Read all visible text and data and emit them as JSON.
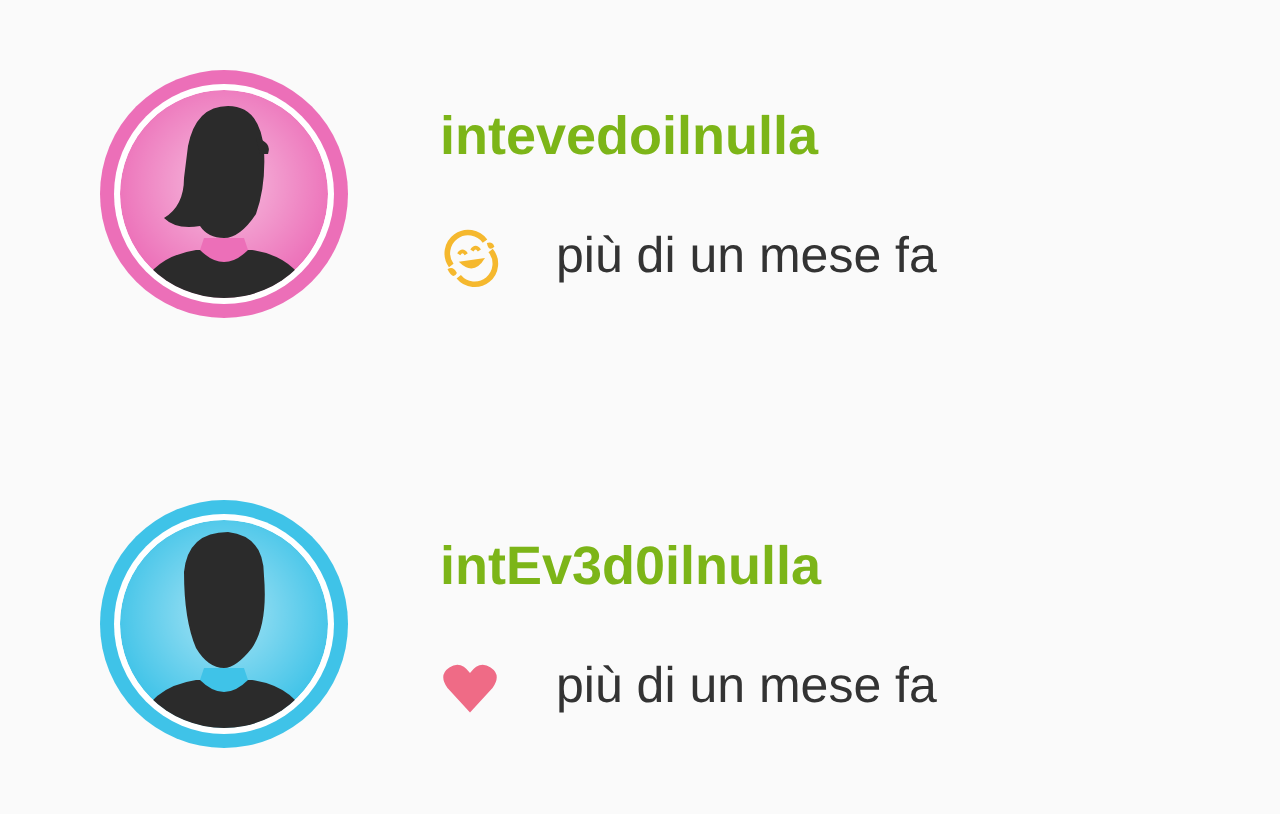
{
  "items": [
    {
      "username": "intevedoilnulla",
      "avatar": {
        "kind": "female",
        "color": "#ec6fb8"
      },
      "reaction": {
        "kind": "laugh"
      },
      "time": "più di un mese fa"
    },
    {
      "username": "intEv3d0ilnulla",
      "avatar": {
        "kind": "male",
        "color": "#3fc3e8"
      },
      "reaction": {
        "kind": "love"
      },
      "time": "più di un mese fa"
    }
  ]
}
